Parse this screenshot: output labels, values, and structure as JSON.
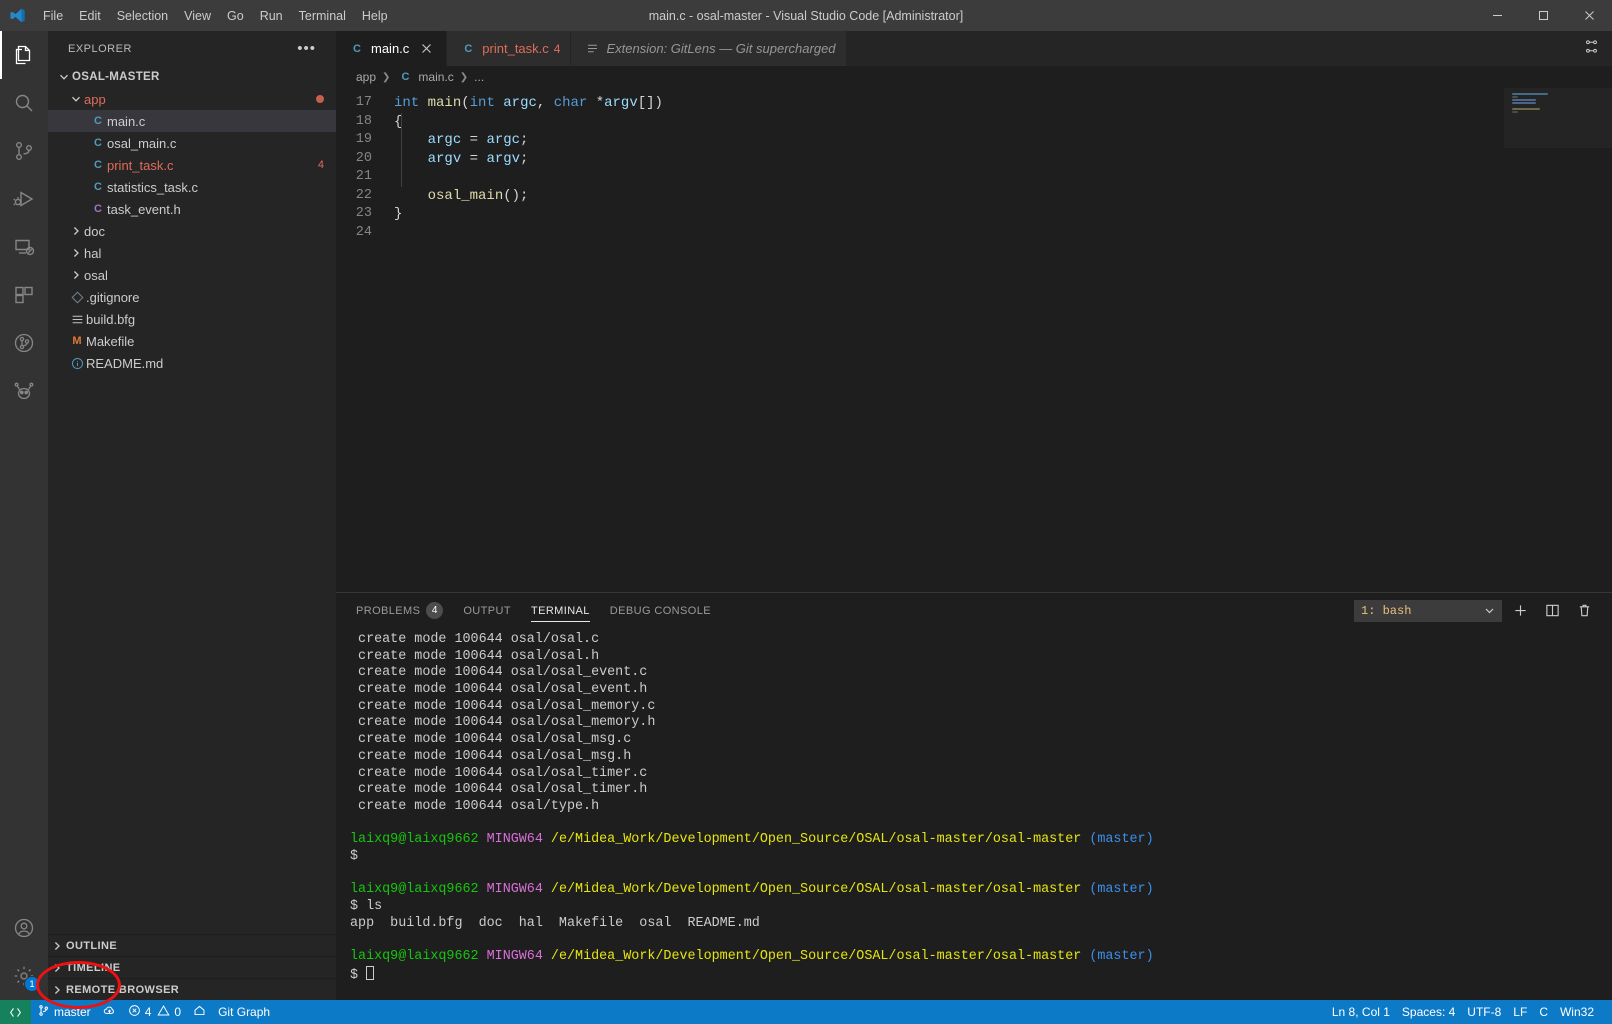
{
  "titlebar": {
    "title": "main.c - osal-master - Visual Studio Code [Administrator]",
    "logo_icon": "vscode-logo-icon",
    "menus": [
      "File",
      "Edit",
      "Selection",
      "View",
      "Go",
      "Run",
      "Terminal",
      "Help"
    ],
    "window_controls": [
      "minimize-icon",
      "maximize-icon",
      "close-icon"
    ]
  },
  "activitybar": {
    "items": [
      {
        "name": "explorer",
        "icon": "files-icon",
        "active": true,
        "badge": null
      },
      {
        "name": "search",
        "icon": "search-icon",
        "active": false,
        "badge": null
      },
      {
        "name": "source-control",
        "icon": "source-control-icon",
        "active": false,
        "badge": null
      },
      {
        "name": "run-and-debug",
        "icon": "run-debug-icon",
        "active": false,
        "badge": null
      },
      {
        "name": "remote-explorer",
        "icon": "remote-explorer-icon",
        "active": false,
        "badge": null
      },
      {
        "name": "extensions",
        "icon": "extensions-icon",
        "active": false,
        "badge": null
      },
      {
        "name": "gitlens",
        "icon": "gitlens-icon",
        "active": false,
        "badge": null
      },
      {
        "name": "testing",
        "icon": "beaker-bug-icon",
        "active": false,
        "badge": null
      }
    ],
    "bottom_items": [
      {
        "name": "accounts",
        "icon": "account-icon",
        "badge": null
      },
      {
        "name": "manage-settings",
        "icon": "gear-icon",
        "badge": "1"
      }
    ]
  },
  "sidebar": {
    "title": "EXPLORER",
    "more_actions_icon": "ellipsis-icon",
    "root": {
      "label": "OSAL-MASTER",
      "expanded": true
    },
    "tree": [
      {
        "label": "app",
        "type": "folder",
        "expanded": true,
        "depth": 1,
        "color": "#e06c5a",
        "dirty": true
      },
      {
        "label": "main.c",
        "type": "c",
        "depth": 2,
        "selected": true
      },
      {
        "label": "osal_main.c",
        "type": "c",
        "depth": 2
      },
      {
        "label": "print_task.c",
        "type": "c",
        "depth": 2,
        "color": "#e06c5a",
        "badge": "4"
      },
      {
        "label": "statistics_task.c",
        "type": "c",
        "depth": 2
      },
      {
        "label": "task_event.h",
        "type": "h",
        "depth": 2
      },
      {
        "label": "doc",
        "type": "folder",
        "expanded": false,
        "depth": 1
      },
      {
        "label": "hal",
        "type": "folder",
        "expanded": false,
        "depth": 1
      },
      {
        "label": "osal",
        "type": "folder",
        "expanded": false,
        "depth": 1
      },
      {
        "label": ".gitignore",
        "type": "git",
        "depth": 1
      },
      {
        "label": "build.bfg",
        "type": "settings",
        "depth": 1
      },
      {
        "label": "Makefile",
        "type": "makefile",
        "depth": 1
      },
      {
        "label": "README.md",
        "type": "info",
        "depth": 1
      }
    ],
    "sections": [
      {
        "label": "OUTLINE",
        "expanded": false
      },
      {
        "label": "TIMELINE",
        "expanded": false
      },
      {
        "label": "REMOTE BROWSER",
        "expanded": false
      }
    ]
  },
  "editor": {
    "tabs": [
      {
        "label": "main.c",
        "icon": "c-file-icon",
        "active": true,
        "badge": null,
        "closable": true,
        "italic": false
      },
      {
        "label": "print_task.c",
        "icon": "c-file-icon",
        "active": false,
        "badge": "4",
        "closable": false,
        "italic": false,
        "color": "#e06c5a"
      },
      {
        "label": "Extension: GitLens — Git supercharged",
        "icon": "extension-icon",
        "active": false,
        "badge": null,
        "closable": false,
        "italic": true
      }
    ],
    "tabbar_action_icon": "split-editor-icon",
    "breadcrumbs": [
      "app",
      "main.c",
      "..."
    ],
    "line_start": 17,
    "lines": [
      {
        "num": 17,
        "tokens": [
          {
            "t": "int",
            "c": "#569cd6"
          },
          {
            "t": " ",
            "c": "#d4d4d4"
          },
          {
            "t": "main",
            "c": "#dcdcaa"
          },
          {
            "t": "(",
            "c": "#d4d4d4"
          },
          {
            "t": "int",
            "c": "#569cd6"
          },
          {
            "t": " ",
            "c": "#d4d4d4"
          },
          {
            "t": "argc",
            "c": "#9cdcfe"
          },
          {
            "t": ", ",
            "c": "#d4d4d4"
          },
          {
            "t": "char",
            "c": "#569cd6"
          },
          {
            "t": " *",
            "c": "#d4d4d4"
          },
          {
            "t": "argv",
            "c": "#9cdcfe"
          },
          {
            "t": "[])",
            "c": "#d4d4d4"
          }
        ]
      },
      {
        "num": 18,
        "tokens": [
          {
            "t": "{",
            "c": "#d4d4d4"
          }
        ]
      },
      {
        "num": 19,
        "tokens": [
          {
            "t": "    ",
            "c": "#d4d4d4"
          },
          {
            "t": "argc",
            "c": "#9cdcfe"
          },
          {
            "t": " = ",
            "c": "#d4d4d4"
          },
          {
            "t": "argc",
            "c": "#9cdcfe"
          },
          {
            "t": ";",
            "c": "#d4d4d4"
          }
        ]
      },
      {
        "num": 20,
        "tokens": [
          {
            "t": "    ",
            "c": "#d4d4d4"
          },
          {
            "t": "argv",
            "c": "#9cdcfe"
          },
          {
            "t": " = ",
            "c": "#d4d4d4"
          },
          {
            "t": "argv",
            "c": "#9cdcfe"
          },
          {
            "t": ";",
            "c": "#d4d4d4"
          }
        ]
      },
      {
        "num": 21,
        "tokens": []
      },
      {
        "num": 22,
        "tokens": [
          {
            "t": "    ",
            "c": "#d4d4d4"
          },
          {
            "t": "osal_main",
            "c": "#dcdcaa"
          },
          {
            "t": "();",
            "c": "#d4d4d4"
          }
        ]
      },
      {
        "num": 23,
        "tokens": [
          {
            "t": "}",
            "c": "#d4d4d4"
          }
        ]
      },
      {
        "num": 24,
        "tokens": []
      }
    ]
  },
  "panel": {
    "tabs": [
      {
        "label": "PROBLEMS",
        "count": "4",
        "active": false
      },
      {
        "label": "OUTPUT",
        "count": null,
        "active": false
      },
      {
        "label": "TERMINAL",
        "count": null,
        "active": true
      },
      {
        "label": "DEBUG CONSOLE",
        "count": null,
        "active": false
      }
    ],
    "terminal_selector": {
      "value": "1: bash",
      "caret_icon": "chevron-down-icon"
    },
    "actions": [
      {
        "name": "new-terminal",
        "icon": "plus-icon"
      },
      {
        "name": "split-terminal",
        "icon": "split-icon"
      },
      {
        "name": "kill-terminal",
        "icon": "trash-icon"
      }
    ],
    "terminal_lines": [
      [
        {
          "t": " create mode 100644 osal/osal.c",
          "c": "white"
        }
      ],
      [
        {
          "t": " create mode 100644 osal/osal.h",
          "c": "white"
        }
      ],
      [
        {
          "t": " create mode 100644 osal/osal_event.c",
          "c": "white"
        }
      ],
      [
        {
          "t": " create mode 100644 osal/osal_event.h",
          "c": "white"
        }
      ],
      [
        {
          "t": " create mode 100644 osal/osal_memory.c",
          "c": "white"
        }
      ],
      [
        {
          "t": " create mode 100644 osal/osal_memory.h",
          "c": "white"
        }
      ],
      [
        {
          "t": " create mode 100644 osal/osal_msg.c",
          "c": "white"
        }
      ],
      [
        {
          "t": " create mode 100644 osal/osal_msg.h",
          "c": "white"
        }
      ],
      [
        {
          "t": " create mode 100644 osal/osal_timer.c",
          "c": "white"
        }
      ],
      [
        {
          "t": " create mode 100644 osal/osal_timer.h",
          "c": "white"
        }
      ],
      [
        {
          "t": " create mode 100644 osal/type.h",
          "c": "white"
        }
      ],
      [],
      [
        {
          "t": "laixq9@laixq9662",
          "c": "user"
        },
        {
          "t": " ",
          "c": "white"
        },
        {
          "t": "MINGW64",
          "c": "host"
        },
        {
          "t": " ",
          "c": "white"
        },
        {
          "t": "/e/Midea_Work/Development/Open_Source/OSAL/osal-master/osal-master",
          "c": "path"
        },
        {
          "t": " ",
          "c": "white"
        },
        {
          "t": "(master)",
          "c": "branch"
        }
      ],
      [
        {
          "t": "$ ",
          "c": "white"
        }
      ],
      [],
      [
        {
          "t": "laixq9@laixq9662",
          "c": "user"
        },
        {
          "t": " ",
          "c": "white"
        },
        {
          "t": "MINGW64",
          "c": "host"
        },
        {
          "t": " ",
          "c": "white"
        },
        {
          "t": "/e/Midea_Work/Development/Open_Source/OSAL/osal-master/osal-master",
          "c": "path"
        },
        {
          "t": " ",
          "c": "white"
        },
        {
          "t": "(master)",
          "c": "branch"
        }
      ],
      [
        {
          "t": "$ ls",
          "c": "white"
        }
      ],
      [
        {
          "t": "app  build.bfg  doc  hal  Makefile  osal  README.md",
          "c": "white"
        }
      ],
      [],
      [
        {
          "t": "laixq9@laixq9662",
          "c": "user"
        },
        {
          "t": " ",
          "c": "white"
        },
        {
          "t": "MINGW64",
          "c": "host"
        },
        {
          "t": " ",
          "c": "white"
        },
        {
          "t": "/e/Midea_Work/Development/Open_Source/OSAL/osal-master/osal-master",
          "c": "path"
        },
        {
          "t": " ",
          "c": "white"
        },
        {
          "t": "(master)",
          "c": "branch"
        }
      ],
      [
        {
          "t": "$ ",
          "c": "white"
        },
        {
          "t": "CURSOR",
          "c": "cursor"
        }
      ]
    ]
  },
  "statusbar": {
    "remote": {
      "icon": "remote-indicator-icon",
      "label": ""
    },
    "left_items": [
      {
        "name": "branch",
        "icon": "git-branch-icon",
        "label": "master",
        "highlighted": true
      },
      {
        "name": "sync",
        "icon": "cloud-sync-icon",
        "label": ""
      },
      {
        "name": "problems",
        "icon": "error-warning-icon",
        "label": "4 ⚠ 0",
        "error_count": "4",
        "warning_count": "0"
      },
      {
        "name": "home",
        "icon": "home-icon",
        "label": ""
      },
      {
        "name": "git-graph",
        "icon": null,
        "label": "Git Graph"
      }
    ],
    "right_items": [
      {
        "name": "cursor-position",
        "label": "Ln 8, Col 1"
      },
      {
        "name": "indentation",
        "label": "Spaces: 4"
      },
      {
        "name": "encoding",
        "label": "UTF-8"
      },
      {
        "name": "eol",
        "label": "LF"
      },
      {
        "name": "language-mode",
        "label": "C"
      },
      {
        "name": "platform",
        "label": "Win32"
      }
    ],
    "accent_color": "#0d7ac7",
    "remote_color": "#16825d"
  },
  "annotation": {
    "shape": "ellipse",
    "color": "#ee1111",
    "target": "status-bar-branch-master"
  }
}
